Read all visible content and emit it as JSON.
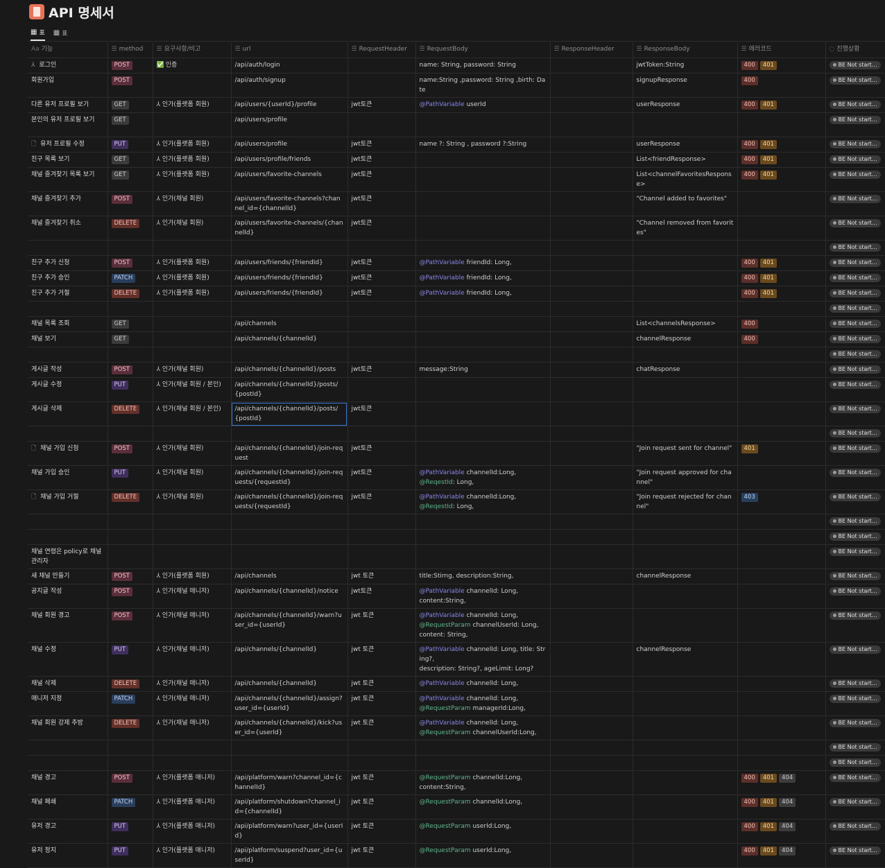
{
  "page": {
    "title": "API 명세서"
  },
  "tabs": [
    {
      "label": "표"
    },
    {
      "label": "표"
    }
  ],
  "columns": [
    "기능",
    "method",
    "요구사항/비고",
    "url",
    "RequestHeader",
    "RequestBody",
    "ResponseHeader",
    "ResponseBody",
    "에러코드",
    "진행상황"
  ],
  "column_icons": [
    "Aa",
    "☰",
    "☰",
    "☰",
    "☰",
    "☰",
    "☰",
    "☰",
    "☰",
    "◌"
  ],
  "colors": {
    "POST": "#5a2e3a",
    "GET": "#3b3b3b",
    "PUT": "#3f2f5c",
    "DELETE": "#63302a",
    "PATCH": "#2a3e5c"
  },
  "rows": [
    {
      "name": "로그인",
      "icon": "person-icon",
      "method": "POST",
      "req": "인증",
      "req_icon": "check-icon",
      "url": "/api/auth/login",
      "header": "",
      "body": [
        [
          "",
          "name: String, password: String"
        ]
      ],
      "resp": "jwtToken:String",
      "errors": [
        "400",
        "401"
      ],
      "status": "BE Not start…",
      "h": 22
    },
    {
      "name": "회원가입",
      "method": "POST",
      "req": "",
      "url": "/api/auth/signup",
      "header": "",
      "body": [
        [
          "",
          "name:String ,password: String ,birth: Date"
        ]
      ],
      "resp": "signupResponse",
      "errors": [
        "400"
      ],
      "status": "BE Not start…",
      "h": 22
    },
    {
      "name": "다른 유저 프로필 보기",
      "method": "GET",
      "req": "인가(플랫폼 회원)",
      "req_icon": "person-icon",
      "url": "/api/users/{userId}/profile",
      "header": "jwt토큰",
      "body": [
        [
          "@PathVariable",
          " userId"
        ]
      ],
      "resp": "userResponse",
      "errors": [
        "400",
        "401"
      ],
      "status": "BE Not start…",
      "h": 22
    },
    {
      "name": "본인의 유저 프로필 보기",
      "method": "GET",
      "req": "",
      "url": "/api/users/profile",
      "header": "",
      "body": [],
      "resp": "",
      "errors": [],
      "status": "BE Not start…",
      "h": 35
    },
    {
      "name": "유저 프로필 수정",
      "icon": "doc-icon",
      "method": "PUT",
      "req": "인가(플랫폼 회원)",
      "req_icon": "person-icon",
      "url": "/api/users/profile",
      "header": "jwt토큰",
      "body": [
        [
          "",
          "name ?: String , password ?:String"
        ]
      ],
      "resp": "userResponse",
      "errors": [
        "400",
        "401"
      ],
      "status": "BE Not start…",
      "h": 22
    },
    {
      "name": "친구 목록 보기",
      "method": "GET",
      "req": "인가(플랫폼 회원)",
      "req_icon": "person-icon",
      "url": "/api/users/profile/friends",
      "header": "jwt토큰",
      "body": [],
      "resp": "List<friendResponse>",
      "errors": [
        "400",
        "401"
      ],
      "status": "BE Not start…",
      "h": 22
    },
    {
      "name": "채널 즐겨찾기 목록 보기",
      "method": "GET",
      "req": "인가(플랫폼 회원)",
      "req_icon": "person-icon",
      "url": "/api/users/favorite-channels",
      "header": "jwt토큰",
      "body": [],
      "resp": "List<channelFavoritesResponse>",
      "errors": [
        "400",
        "401"
      ],
      "status": "BE Not start…",
      "h": 35
    },
    {
      "name": "채널 즐겨찾기 추가",
      "method": "POST",
      "req": "인가(채널 회원)",
      "req_icon": "person-icon",
      "url": "/api/users/favorite-channels?channel_id={channelId}",
      "header": "jwt토큰",
      "body": [],
      "resp": "\"Channel added to favorites\"",
      "errors": [],
      "status": "BE Not start…",
      "h": 35
    },
    {
      "name": "채널 즐겨찾기 취소",
      "method": "DELETE",
      "req": "인가(채널 회원)",
      "req_icon": "person-icon",
      "url": "/api/users/favorite-channels/{channelId}",
      "header": "jwt토큰",
      "body": [],
      "resp": "\"Channel removed from favorites\"",
      "errors": [],
      "status": "BE Not start…",
      "h": 35
    },
    {
      "name": "",
      "method": "",
      "req": "",
      "url": "",
      "header": "",
      "body": [],
      "resp": "",
      "errors": [],
      "status": "BE Not start…",
      "h": 22
    },
    {
      "name": "친구 추가 신청",
      "method": "POST",
      "req": "인가(플랫폼 회원)",
      "req_icon": "person-icon",
      "url": "/api/users/friends/{friendId}",
      "header": "jwt토큰",
      "body": [
        [
          "@PathVariable",
          " friendId: Long,"
        ]
      ],
      "resp": "",
      "errors": [
        "400",
        "401"
      ],
      "status": "BE Not start…",
      "h": 22
    },
    {
      "name": "친구 추가 승인",
      "method": "PATCH",
      "req": "인가(플랫폼 회원)",
      "req_icon": "person-icon",
      "url": "/api/users/friends/{friendId}",
      "header": "jwt토큰",
      "body": [
        [
          "@PathVariable",
          " friendId: Long,"
        ]
      ],
      "resp": "",
      "errors": [
        "400",
        "401"
      ],
      "status": "BE Not start…",
      "h": 22
    },
    {
      "name": "친구 추가 거절",
      "method": "DELETE",
      "req": "인가(플랫폼 회원)",
      "req_icon": "person-icon",
      "url": "/api/users/friends/{friendId}",
      "header": "jwt토큰",
      "body": [
        [
          "@PathVariable",
          " friendId: Long,"
        ]
      ],
      "resp": "",
      "errors": [
        "400",
        "401"
      ],
      "status": "BE Not start…",
      "h": 22
    },
    {
      "name": "",
      "method": "",
      "req": "",
      "url": "",
      "header": "",
      "body": [],
      "resp": "",
      "errors": [],
      "status": "BE Not start…",
      "h": 22
    },
    {
      "name": "채널 목록 조회",
      "method": "GET",
      "req": "",
      "url": "/api/channels",
      "header": "",
      "body": [],
      "resp": "List<channelsResponse>",
      "errors": [
        "400"
      ],
      "status": "BE Not start…",
      "h": 22
    },
    {
      "name": "채널 보기",
      "method": "GET",
      "req": "",
      "url": "/api/channels/{channelId}",
      "header": "",
      "body": [],
      "resp": "channelResponse",
      "errors": [
        "400"
      ],
      "status": "BE Not start…",
      "h": 22
    },
    {
      "name": "",
      "method": "",
      "req": "",
      "url": "",
      "header": "",
      "body": [],
      "resp": "",
      "errors": [],
      "status": "BE Not start…",
      "h": 22
    },
    {
      "name": "게시글 작성",
      "method": "POST",
      "req": "인가(채널 회원)",
      "req_icon": "person-icon",
      "url": "/api/channels/{channelId}/posts",
      "header": "jwt토큰",
      "body": [
        [
          "",
          "message:String"
        ]
      ],
      "resp": "chatResponse",
      "errors": [],
      "status": "BE Not start…",
      "h": 22
    },
    {
      "name": "게시글 수정",
      "method": "PUT",
      "req": "인가(채널 회원 / 본인)",
      "req_icon": "person-icon",
      "url": "/api/channels/{channelId}/posts/{postId}",
      "header": "",
      "body": [],
      "resp": "",
      "errors": [],
      "status": "BE Not start…",
      "h": 35
    },
    {
      "name": "게시글 삭제",
      "method": "DELETE",
      "req": "인가(채널 회원 / 본인)",
      "req_icon": "person-icon",
      "url": "/api/channels/{channelId}/posts/{postId}",
      "header": "jwt토큰",
      "body": [],
      "resp": "",
      "errors": [],
      "status": "BE Not start…",
      "h": 35,
      "selected": true
    },
    {
      "name": "",
      "method": "",
      "req": "",
      "url": "",
      "header": "",
      "body": [],
      "resp": "",
      "errors": [],
      "status": "BE Not start…",
      "h": 22
    },
    {
      "name": "채널 가입 신청",
      "icon": "doc-icon",
      "method": "POST",
      "req": "인가(채널 회원)",
      "req_icon": "person-icon",
      "url": "/api/channels/{channelId}/join-request",
      "header": "jwt토큰",
      "body": [],
      "resp": "\"Join request sent for channel\"",
      "errors": [
        "401"
      ],
      "status": "BE Not start…",
      "h": 35
    },
    {
      "name": "채널 가입 승인",
      "method": "PUT",
      "req": "인가(채널 회원)",
      "req_icon": "person-icon",
      "url": "/api/channels/{channelId}/join-requests/{requestId}",
      "header": "jwt토큰",
      "body": [
        [
          "@PathVariable",
          " channelId:Long,"
        ],
        [
          "@ReqestId",
          ": Long,"
        ]
      ],
      "resp": "\"Join request approved for channel\"",
      "errors": [],
      "status": "BE Not start…",
      "h": 35
    },
    {
      "name": "채널 가입 거절",
      "icon": "doc-icon",
      "method": "DELETE",
      "req": "인가(채널 회원)",
      "req_icon": "person-icon",
      "url": "/api/channels/{channelId}/join-requests/{requestId}",
      "header": "jwt토큰",
      "body": [
        [
          "@PathVariable",
          " channelId:Long,"
        ],
        [
          "@ReqestId",
          ": Long,"
        ]
      ],
      "resp": "\"Join request rejected for channel\"",
      "errors": [
        "403"
      ],
      "status": "BE Not start…",
      "h": 35
    },
    {
      "name": "",
      "method": "",
      "req": "",
      "url": "",
      "header": "",
      "body": [],
      "resp": "",
      "errors": [],
      "status": "BE Not start…",
      "h": 22
    },
    {
      "name": "",
      "method": "",
      "req": "",
      "url": "",
      "header": "",
      "body": [],
      "resp": "",
      "errors": [],
      "status": "BE Not start…",
      "h": 22
    },
    {
      "name": "채널 연령은 policy로 채널 관리자",
      "method": "",
      "req": "",
      "url": "",
      "header": "",
      "body": [],
      "resp": "",
      "errors": [],
      "status": "BE Not start…",
      "h": 35
    },
    {
      "name": "새 채널 만들기",
      "method": "POST",
      "req": "인가(플랫폼 회원)",
      "req_icon": "person-icon",
      "url": "/api/channels",
      "header": "jwt 토큰",
      "body": [
        [
          "",
          "title:Stirng, description:String,"
        ]
      ],
      "resp": "channelResponse",
      "errors": [],
      "status": "BE Not start…",
      "h": 22
    },
    {
      "name": "공지글 작성",
      "method": "POST",
      "req": "인가(채널 매니저)",
      "req_icon": "person-icon",
      "url": "/api/channels/{channelId}/notice",
      "header": "jwt토큰",
      "body": [
        [
          "@PathVariable",
          " channelId: Long,"
        ],
        [
          "",
          "content:String,"
        ]
      ],
      "resp": "",
      "errors": [],
      "status": "BE Not start…",
      "h": 35
    },
    {
      "name": "채널 회원 경고",
      "method": "POST",
      "req": "인가(채널 매니저)",
      "req_icon": "person-icon",
      "url": "/api/channels/{channelId}/warn?user_id={userId}",
      "header": "jwt 토큰",
      "body": [
        [
          "@PathVariable",
          " channelId: Long,"
        ],
        [
          "@RequestParam",
          "  channelUserId: Long,"
        ],
        [
          "",
          "content: String,"
        ]
      ],
      "resp": "",
      "errors": [],
      "status": "BE Not start…",
      "h": 49
    },
    {
      "name": "채널 수정",
      "method": "PUT",
      "req": "인가(채널 매니저)",
      "req_icon": "person-icon",
      "url": "/api/channels/{channelId}",
      "header": "jwt 토큰",
      "body": [
        [
          "@PathVariable",
          " channelId: Long, title: String?,"
        ],
        [
          "",
          "description: String?, ageLimit: Long?"
        ]
      ],
      "resp": "channelResponse",
      "errors": [],
      "status": "BE Not start…",
      "h": 35
    },
    {
      "name": "채널 삭제",
      "method": "DELETE",
      "req": "인가(채널 매니저)",
      "req_icon": "person-icon",
      "url": "/api/channels/{channelId}",
      "header": "jwt 토큰",
      "body": [
        [
          "@PathVariable",
          " channelId: Long,"
        ]
      ],
      "resp": "",
      "errors": [],
      "status": "BE Not start…",
      "h": 22
    },
    {
      "name": "매니저 지정",
      "method": "PATCH",
      "req": "인가(채널 매니저)",
      "req_icon": "person-icon",
      "url": "/api/channels/{channelId}/assign?user_id={userId}",
      "header": "jwt 토큰",
      "body": [
        [
          "@PathVariable",
          " channelId: Long,"
        ],
        [
          "@RequestParam",
          " managerId:Long,"
        ]
      ],
      "resp": "",
      "errors": [],
      "status": "BE Not start…",
      "h": 35
    },
    {
      "name": "채널 회원 강제 추방",
      "method": "DELETE",
      "req": "인가(채널 매니저)",
      "req_icon": "person-icon",
      "url": "/api/channels/{channelId}/kick?user_id={userId}",
      "header": "jwt 토큰",
      "body": [
        [
          "@PathVariable",
          " channelId: Long,"
        ],
        [
          "@RequestParam",
          " channelUserId:Long,"
        ]
      ],
      "resp": "",
      "errors": [],
      "status": "BE Not start…",
      "h": 35
    },
    {
      "name": "",
      "method": "",
      "req": "",
      "url": "",
      "header": "",
      "body": [],
      "resp": "",
      "errors": [],
      "status": "BE Not start…",
      "h": 22
    },
    {
      "name": "",
      "method": "",
      "req": "",
      "url": "",
      "header": "",
      "body": [],
      "resp": "",
      "errors": [],
      "status": "BE Not start…",
      "h": 22
    },
    {
      "name": "채널 경고",
      "method": "POST",
      "req": "인가(플랫폼 매니저)",
      "req_icon": "person-icon",
      "url": "/api/platform/warn?channel_id={channelId}",
      "header": "jwt 토큰",
      "body": [
        [
          "@RequestParam",
          " channelId:Long,"
        ],
        [
          "",
          "content:String,"
        ]
      ],
      "resp": "",
      "errors": [
        "400",
        "401",
        "404"
      ],
      "status": "BE Not start…",
      "h": 35
    },
    {
      "name": "채널 폐쇄",
      "method": "PATCH",
      "req": "인가(플랫폼 매니저)",
      "req_icon": "person-icon",
      "url": "/api/platform/shutdown?channel_id={channelId}",
      "header": "jwt 토큰",
      "body": [
        [
          "@RequestParam",
          " channelId:Long,"
        ]
      ],
      "resp": "",
      "errors": [
        "400",
        "401",
        "404"
      ],
      "status": "BE Not start…",
      "h": 35
    },
    {
      "name": "유저 경고",
      "method": "PUT",
      "req": "인가(플랫폼 매니저)",
      "req_icon": "person-icon",
      "url": "/api/platform/warn?user_id={userId}",
      "header": "jwt 토큰",
      "body": [
        [
          "@RequestParam",
          " userId:Long,"
        ]
      ],
      "resp": "",
      "errors": [
        "400",
        "401",
        "404"
      ],
      "status": "BE Not start…",
      "h": 22
    },
    {
      "name": "유저 정지",
      "method": "PUT",
      "req": "인가(플랫폼 매니저)",
      "req_icon": "person-icon",
      "url": "/api/platform/suspend?user_id={userId}",
      "header": "jwt 토큰",
      "body": [
        [
          "@RequestParam",
          " userId:Long,"
        ]
      ],
      "resp": "",
      "errors": [
        "400",
        "401",
        "404"
      ],
      "status": "BE Not start…",
      "h": 35
    }
  ]
}
